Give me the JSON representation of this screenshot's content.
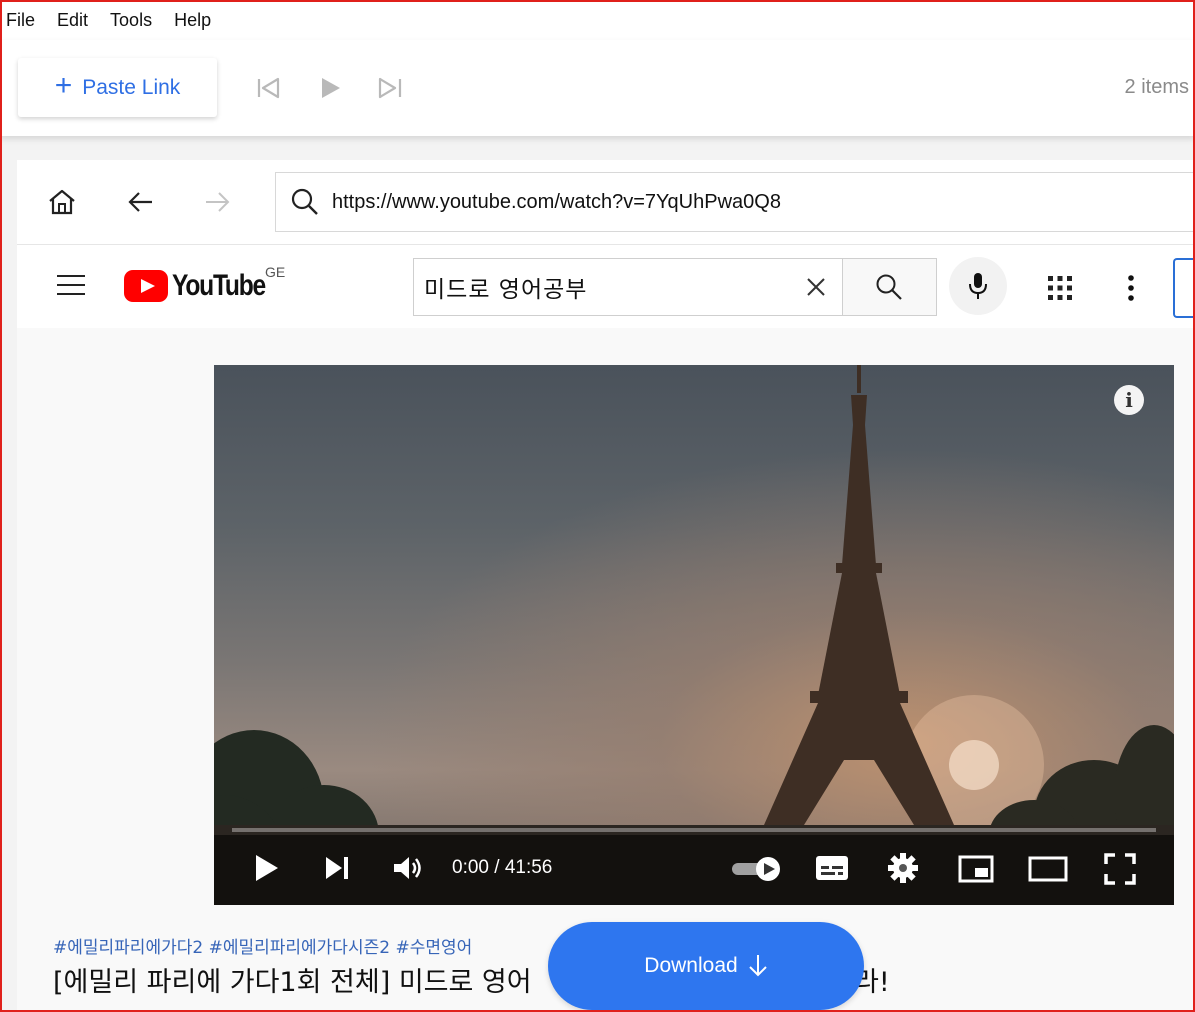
{
  "menu": {
    "file": "File",
    "edit": "Edit",
    "tools": "Tools",
    "help": "Help"
  },
  "toolbar": {
    "paste_label": "Paste Link",
    "items_count": "2 items"
  },
  "browser": {
    "url": "https://www.youtube.com/watch?v=7YqUhPwa0Q8"
  },
  "youtube": {
    "logo_text": "YouTube",
    "region": "GE",
    "search_query": "미드로 영어공부",
    "video": {
      "time_display": "0:00 / 41:56",
      "progress": 0,
      "tags": "#에밀리파리에가다2 #에밀리파리에가다시즌2 #수면영어",
      "title_left": "[에밀리 파리에 가다1회 전체] 미드로 영어",
      "title_right": "라!"
    }
  },
  "download": {
    "label": "Download"
  },
  "colors": {
    "accent": "#2e76ef",
    "youtube_red": "#ff0000",
    "frame": "#e0201b"
  }
}
